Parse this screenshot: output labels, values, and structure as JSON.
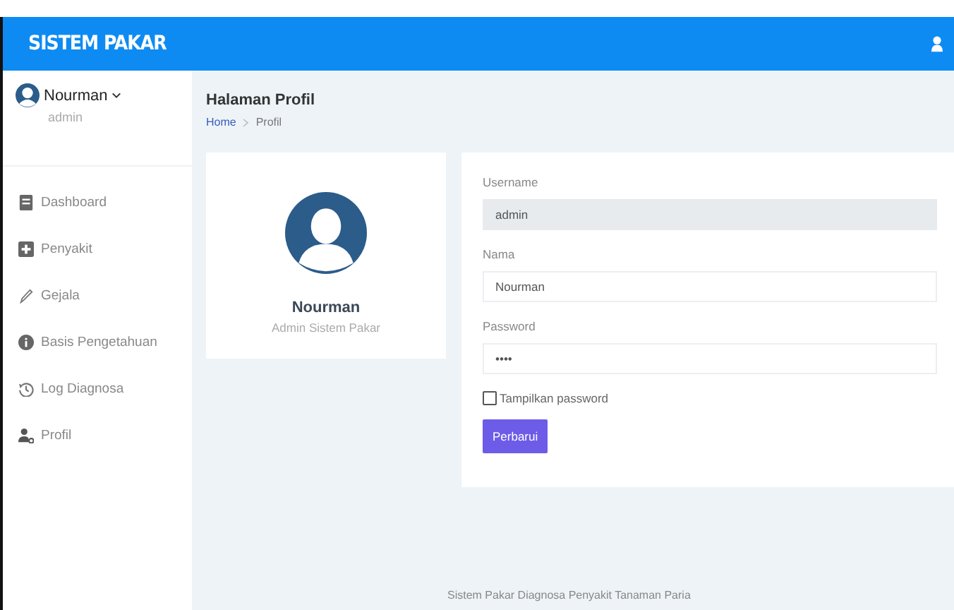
{
  "topbar": {
    "brand": "SISTEM PAKAR"
  },
  "user": {
    "name": "Nourman",
    "role": "admin"
  },
  "sidebar": {
    "items": [
      {
        "label": "Dashboard"
      },
      {
        "label": "Penyakit"
      },
      {
        "label": "Gejala"
      },
      {
        "label": "Basis Pengetahuan"
      },
      {
        "label": "Log Diagnosa"
      },
      {
        "label": "Profil"
      }
    ]
  },
  "page": {
    "title": "Halaman Profil",
    "breadcrumb": [
      {
        "label": "Home",
        "kind": "link"
      },
      {
        "label": "Profil",
        "kind": "current"
      }
    ]
  },
  "profile_card": {
    "name": "Nourman",
    "subtitle": "Admin Sistem Pakar"
  },
  "form": {
    "fields": [
      {
        "label": "Username",
        "value": "admin",
        "disabled": true
      },
      {
        "label": "Nama",
        "value": "Nourman",
        "disabled": false
      },
      {
        "label": "Password",
        "value": "••••",
        "disabled": false
      }
    ],
    "show_password": {
      "label": "Tampilkan password",
      "checked": false
    },
    "button": "Perbarui"
  },
  "footer": "Sistem Pakar Diagnosa Penyakit Tanaman Paria"
}
